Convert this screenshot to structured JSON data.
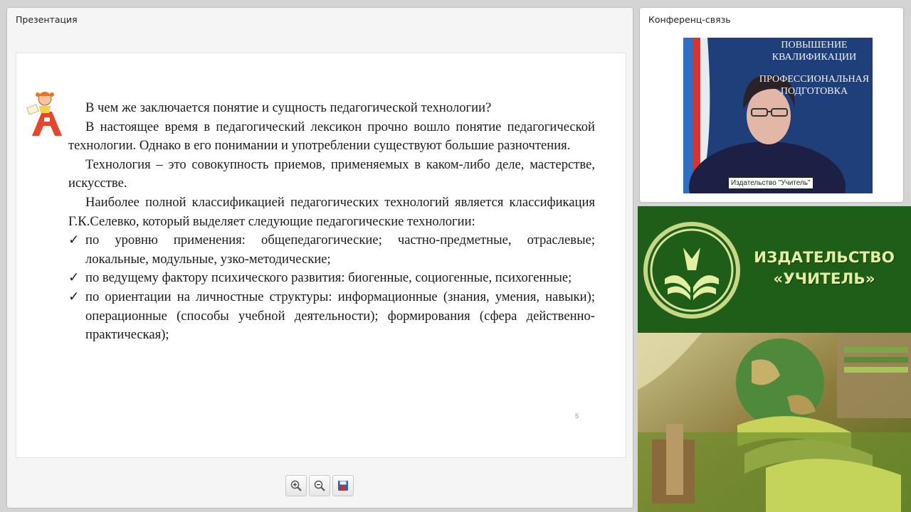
{
  "presentation": {
    "title": "Презентация",
    "slide": {
      "question": "В чем же заключается понятие и сущность педагогической технологии?",
      "para1": "В настоящее время в педагогический лексикон прочно вошло понятие педагогической технологии. Однако в его понимании и употреблении существуют большие разночтения.",
      "para2": "Технология – это совокупность приемов, применяемых в каком-либо деле, мастерстве, искусстве.",
      "para3": "Наиболее полной классификацией педагогических технологий является классификация Г.К.Селевко, который выделяет следующие педагогические технологии:",
      "bullet_mark": "✓",
      "bullets": [
        "по уровню применения: общепедагогические; частно-предметные, отраслевые; локальные, модульные, узко-методические;",
        "по ведущему фактору психического развития: биогенные, социогенные, психогенные;",
        "по ориентации на личностные структуры: информационные (знания, умения, навыки); операционные (способы учебной деятельности); формирования (сфера действенно-практическая);"
      ],
      "page_number": "5"
    },
    "toolbar": {
      "zoom_in_icon": "zoom-in-icon",
      "zoom_out_icon": "zoom-out-icon",
      "save_icon": "save-icon"
    }
  },
  "conference": {
    "title": "Конференц-связь",
    "presenter_label": "Издательство \"Учитель\"",
    "background_banner": {
      "line1": "ПОВЫШЕНИЕ",
      "line2": "КВАЛИФИКАЦИИ",
      "line3": "ПРОФЕССИОНАЛЬНАЯ",
      "line4": "ПОДГОТОВКА"
    }
  },
  "brand": {
    "line1": "ИЗДАТЕЛЬСТВО",
    "line2": "«УЧИТЕЛЬ»",
    "colors": {
      "green": "#1f5e19",
      "gold": "#e3efa3"
    }
  }
}
